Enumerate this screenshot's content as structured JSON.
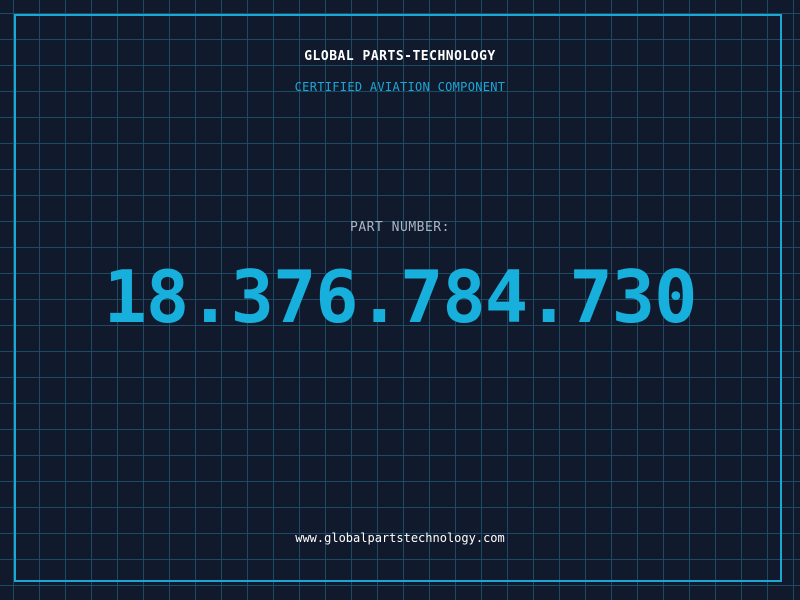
{
  "header": {
    "brand": "GLOBAL PARTS-TECHNOLOGY",
    "subtitle": "CERTIFIED AVIATION COMPONENT"
  },
  "part": {
    "label": "PART NUMBER:",
    "number": "18.376.784.730"
  },
  "footer": {
    "url": "www.globalpartstechnology.com"
  },
  "colors": {
    "background": "#111a2c",
    "grid": "#1c4a62",
    "accent": "#1ba7d6",
    "text_primary": "#ffffff",
    "text_muted": "#a9b6c6"
  }
}
